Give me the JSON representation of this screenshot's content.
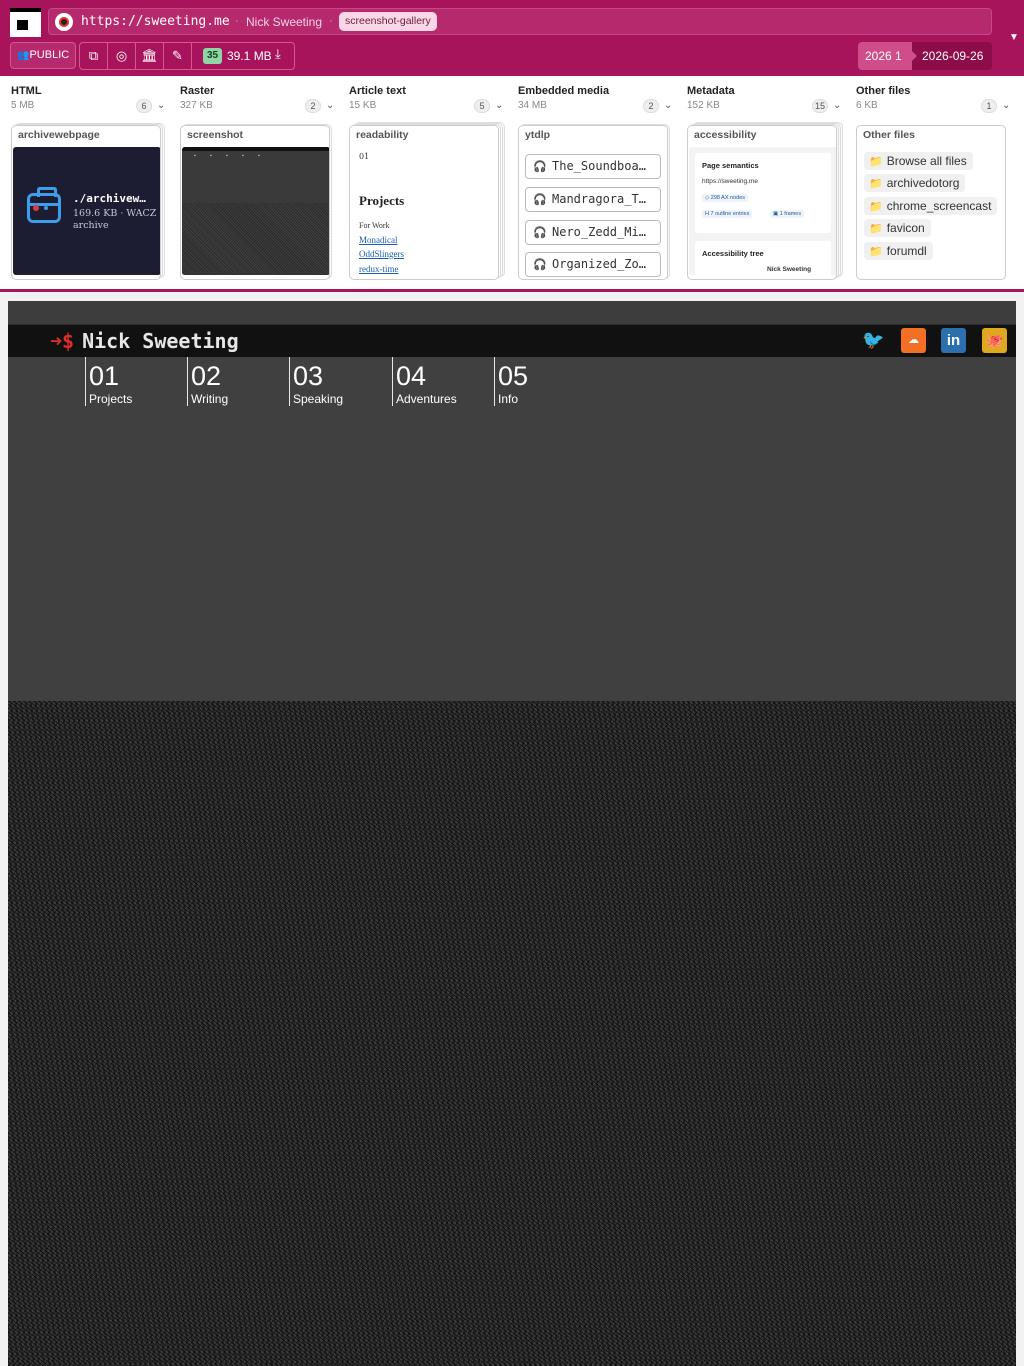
{
  "toolbar": {
    "url": "https://sweeting.me",
    "page_title": "Nick Sweeting",
    "tag": "screenshot-gallery",
    "visibility": "PUBLIC",
    "files_count": "35",
    "total_size": "39.1 MB",
    "date_start": "2026 1",
    "date_end": "2026-09-26",
    "icons": [
      "copy-icon",
      "globe-icon",
      "museum-icon",
      "edit-icon",
      "download-icon"
    ]
  },
  "columns": [
    {
      "title": "HTML",
      "size": "5 MB",
      "count": "6",
      "card_label": "archivewebpage",
      "file_name": "./archivew…",
      "file_meta_1": "169.6 KB · WACZ",
      "file_meta_2": "archive"
    },
    {
      "title": "Raster",
      "size": "327 KB",
      "count": "2",
      "card_label": "screenshot"
    },
    {
      "title": "Article text",
      "size": "15 KB",
      "count": "5",
      "card_label": "readability",
      "preview_num": "01",
      "preview_heading": "Projects",
      "preview_sub": "For Work",
      "preview_links": [
        "Monadical",
        "OddSlingers",
        "redux-time"
      ]
    },
    {
      "title": "Embedded media",
      "size": "34 MB",
      "count": "2",
      "card_label": "ytdlp",
      "items": [
        "The_Soundboa…",
        "Mandragora_T…",
        "Nero_Zedd_Mi…",
        "Organized_Zo…"
      ]
    },
    {
      "title": "Metadata",
      "size": "152 KB",
      "count": "15",
      "card_label": "accessibility",
      "box1_title": "Page semantics",
      "box1_url": "https://sweeting.me",
      "box1_chip1": "◇ 298 AX nodes",
      "box1_chip2": "H 7 outline entries",
      "box1_chip3": "▣ 1 frames",
      "box2_title": "Accessibility tree",
      "box2_item": "Nick Sweeting"
    },
    {
      "title": "Other files",
      "size": "6 KB",
      "count": "1",
      "card_label": "Other files",
      "items": [
        "Browse all files",
        "archivedotorg",
        "chrome_screencast",
        "favicon",
        "forumdl"
      ]
    }
  ],
  "site": {
    "name": "Nick Sweeting",
    "nav": [
      {
        "num": "01",
        "label": "Projects"
      },
      {
        "num": "02",
        "label": "Writing"
      },
      {
        "num": "03",
        "label": "Speaking"
      },
      {
        "num": "04",
        "label": "Adventures"
      },
      {
        "num": "05",
        "label": "Info"
      }
    ],
    "social": [
      "twitter-icon",
      "soundcloud-icon",
      "linkedin-icon",
      "github-icon"
    ]
  },
  "colors": {
    "brand": "#a8145b",
    "files_badge": "#8fd6a4",
    "site_bg": "#404040",
    "site_header": "#111111",
    "prompt_accent": "#e22d2d"
  }
}
